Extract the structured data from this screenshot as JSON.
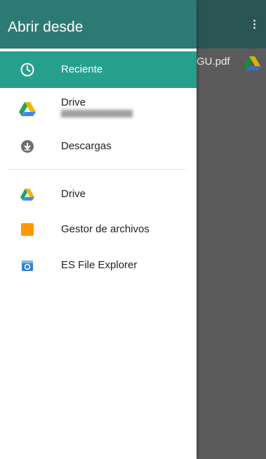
{
  "background": {
    "file_name": "GU.pdf",
    "more_icon": "more-vert-icon",
    "file_icon": "google-drive-icon"
  },
  "drawer": {
    "title": "Abrir desde",
    "roots": [
      {
        "label": "Reciente",
        "icon": "clock-icon",
        "selected": true
      },
      {
        "label": "Drive",
        "icon": "google-drive-icon",
        "account": "████████████████"
      },
      {
        "label": "Descargas",
        "icon": "download-icon"
      }
    ],
    "apps": [
      {
        "label": "Drive",
        "icon": "google-drive-icon"
      },
      {
        "label": "Gestor de archivos",
        "icon": "folder-icon"
      },
      {
        "label": "ES File Explorer",
        "icon": "es-file-explorer-icon"
      }
    ]
  },
  "colors": {
    "header": "#2c7a73",
    "selected_item": "#26a08d",
    "scrim": "#5b5b5b"
  }
}
